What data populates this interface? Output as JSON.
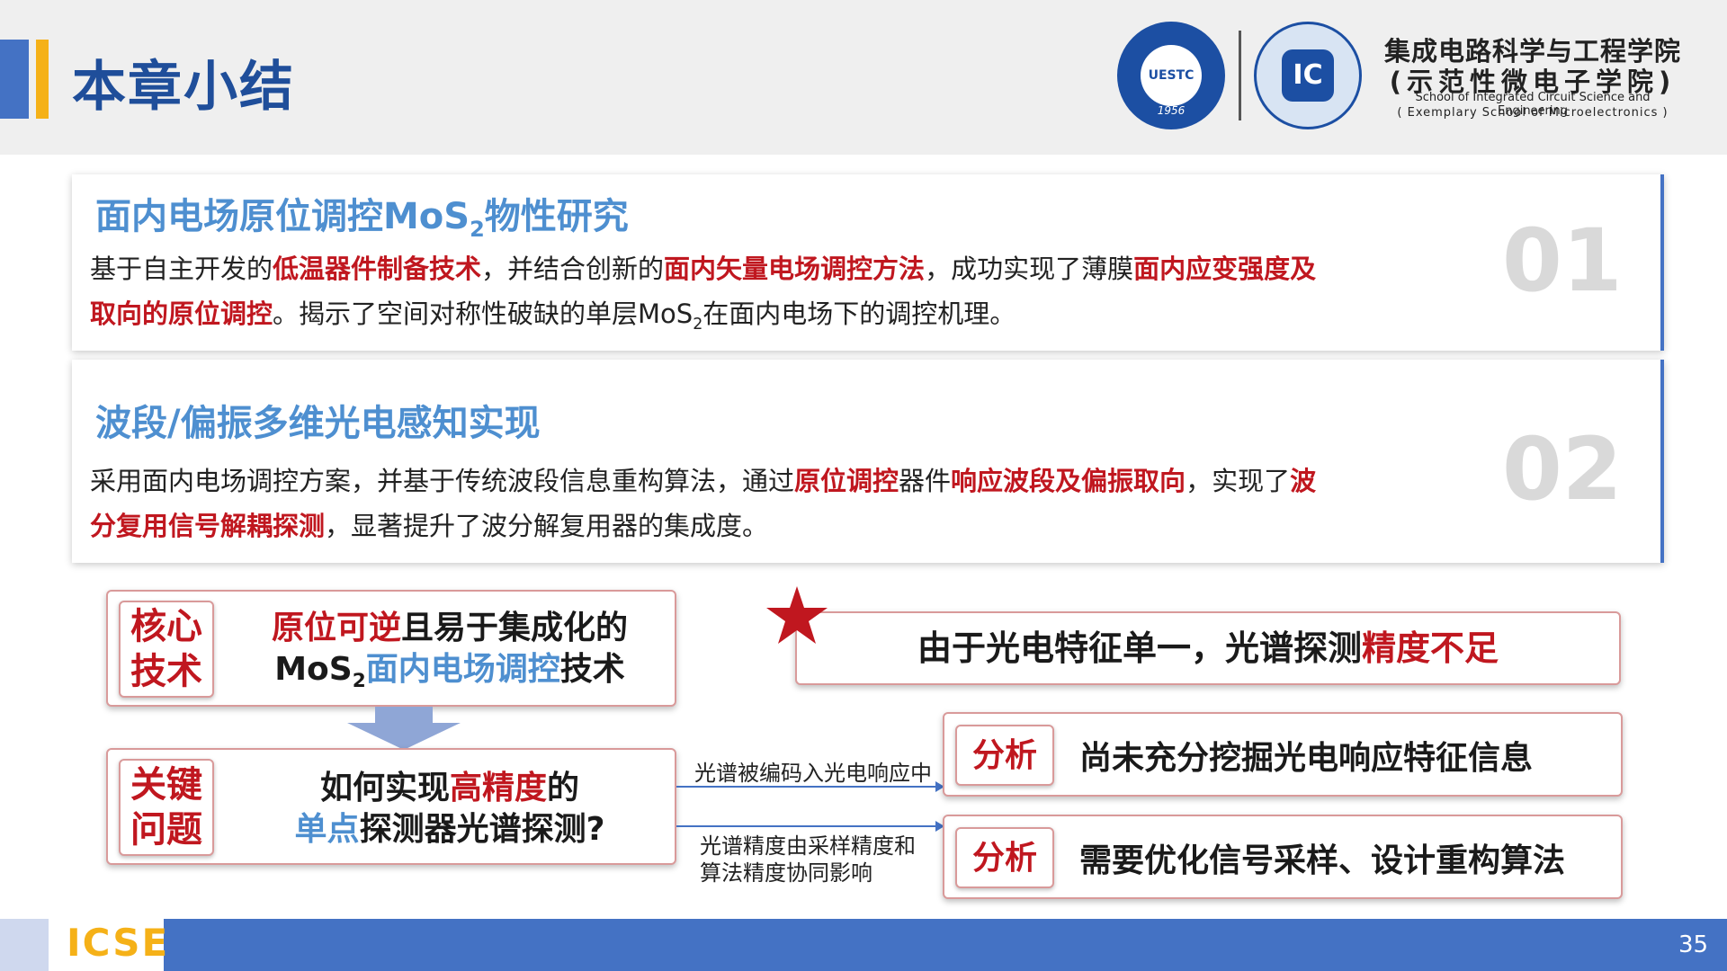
{
  "header": {
    "title": "本章小结",
    "logo_uestc": {
      "center": "UESTC",
      "year": "1956"
    },
    "logo_ic": {
      "center": "IC"
    },
    "school_name_cn_line1": "集成电路科学与工程学院",
    "school_name_cn_line2": "(示范性微电子学院)",
    "school_name_en_line1": "School of Integrated Circuit Science and Engineering",
    "school_name_en_line2": "( Exemplary School of Microelectronics )"
  },
  "cards": [
    {
      "number": "01",
      "title_pre": "面内电场原位调控MoS",
      "title_sub": "2",
      "title_post": "物性研究",
      "body_line1": [
        {
          "text": "基于自主开发的",
          "emph": false
        },
        {
          "text": "低温器件制备技术",
          "emph": true
        },
        {
          "text": "，并结合创新的",
          "emph": false
        },
        {
          "text": "面内矢量电场调控方法",
          "emph": true
        },
        {
          "text": "，成功实现了薄膜",
          "emph": false
        },
        {
          "text": "面内应变强度及",
          "emph": true
        }
      ],
      "body_line2_emph": "取向的原位调控",
      "body_line2_pre": "。揭示了空间对称性破缺的单层MoS",
      "body_line2_sub": "2",
      "body_line2_post": "在面内电场下的调控机理。"
    },
    {
      "number": "02",
      "title": "波段/偏振多维光电感知实现",
      "body_line1": [
        {
          "text": "采用面内电场调控方案，并基于传统波段信息重构算法，通过",
          "emph": false
        },
        {
          "text": "原位调控",
          "emph": true
        },
        {
          "text": "器件",
          "emph": false
        },
        {
          "text": "响应波段及偏振取向",
          "emph": true
        },
        {
          "text": "，实现了",
          "emph": false
        },
        {
          "text": "波",
          "emph": true
        }
      ],
      "body_line2_emph": "分复用信号解耦探测",
      "body_line2_post": "，显著提升了波分解复用器的集成度。"
    }
  ],
  "diagram": {
    "core_tag": [
      "核心",
      "技术"
    ],
    "core_line1_red": "原位可逆",
    "core_line1_rest": "且易于集成化的",
    "core_line2_pre": "MoS",
    "core_line2_sub": "2",
    "core_line2_blue": "面内电场调控",
    "core_line2_post": "技术",
    "key_tag": [
      "关键",
      "问题"
    ],
    "key_line1_pre": "如何实现",
    "key_line1_red": "高精度",
    "key_line1_post": "的",
    "key_line2_blue": "单点",
    "key_line2_post": "探测器光谱探测?",
    "problem_pre": "由于光电特征单一，光谱探测",
    "problem_red": "精度不足",
    "arrow1_label": "光谱被编码入光电响应中",
    "arrow2_label_line1": "光谱精度由采样精度和",
    "arrow2_label_line2": "算法精度协同影响",
    "analysis_tag": "分析",
    "analysis1": "尚未充分挖掘光电响应特征信息",
    "analysis2": "需要优化信号采样、设计重构算法"
  },
  "footer": {
    "logo": "ICSE",
    "page_number": "35"
  },
  "colors": {
    "accent_blue": "#4472c4",
    "accent_gold": "#f5b118",
    "emphasis_red": "#c0171f",
    "title_blue": "#4e8fd0"
  }
}
